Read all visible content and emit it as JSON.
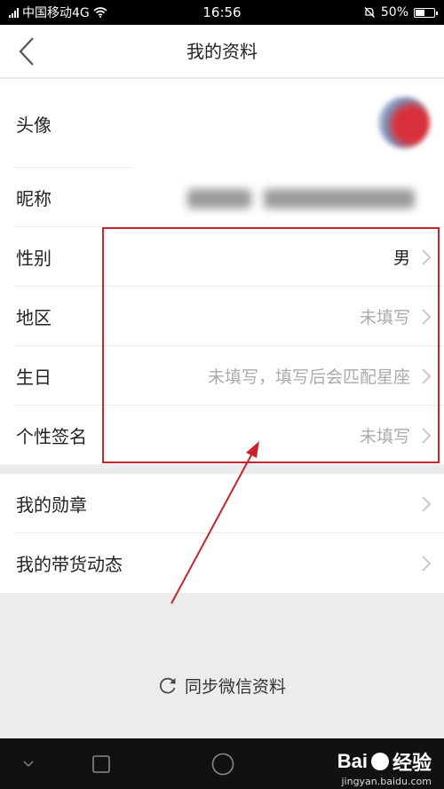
{
  "status_bar": {
    "carrier": "中国移动4G",
    "time": "16:56",
    "battery": "50%"
  },
  "nav": {
    "title": "我的资料"
  },
  "profile_rows": [
    {
      "label": "头像",
      "value": ""
    },
    {
      "label": "昵称",
      "value": ""
    },
    {
      "label": "性别",
      "value": "男"
    },
    {
      "label": "地区",
      "value": "未填写"
    },
    {
      "label": "生日",
      "value": "未填写，填写后会匹配星座"
    },
    {
      "label": "个性签名",
      "value": "未填写"
    }
  ],
  "extra_rows": [
    {
      "label": "我的勋章"
    },
    {
      "label": "我的带货动态"
    }
  ],
  "sync": {
    "label": "同步微信资料",
    "icon": "refresh-icon"
  },
  "watermark": {
    "brand": "Bai",
    "brand_suffix": "经验",
    "url": "jingyan.baidu.com"
  },
  "colors": {
    "highlight": "#c8242b",
    "accent_red": "#c8242b",
    "value_gray": "#aaaaaa"
  }
}
